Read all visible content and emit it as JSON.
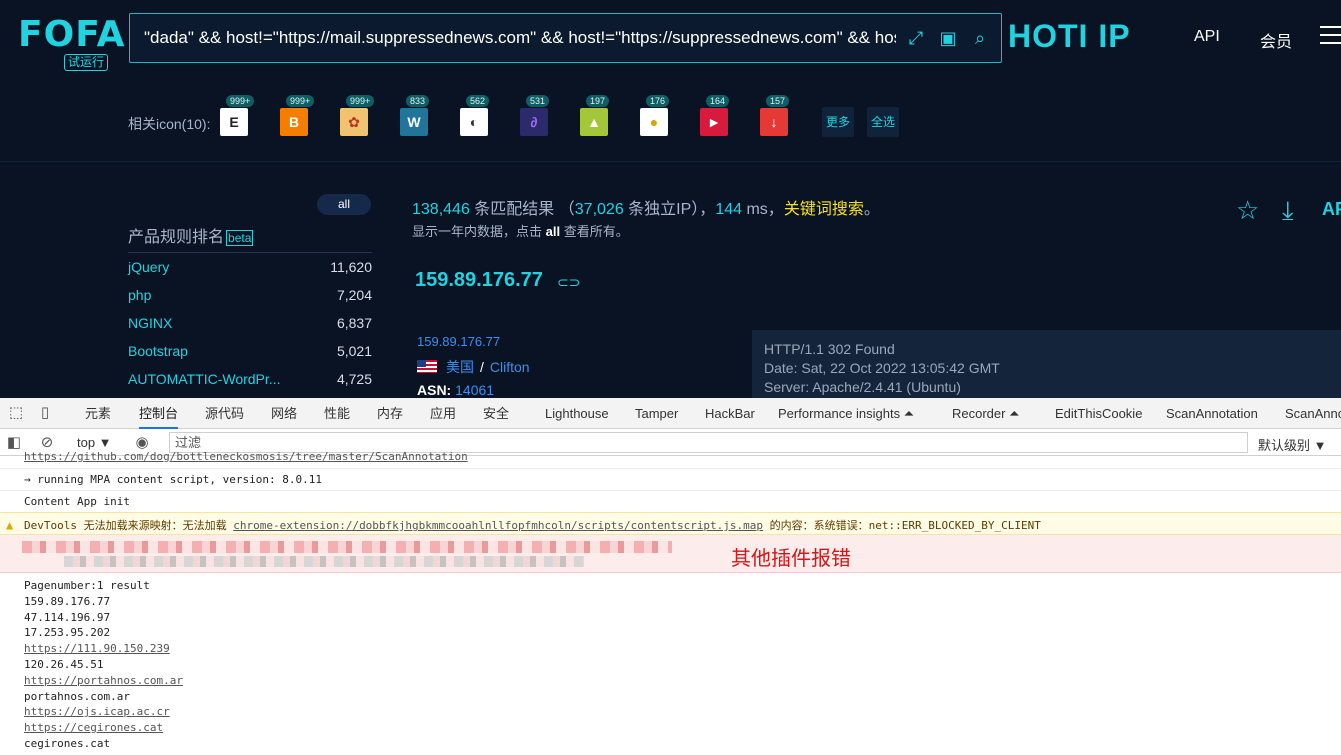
{
  "logo": {
    "text": "FOFA",
    "badge": "试运行"
  },
  "search": {
    "query": "\"dada\" && host!=\"https://mail.suppressednews.com\" && host!=\"https://suppressednews.com\" && host!=\"ti"
  },
  "header": {
    "hoti": "HOTI IP",
    "api": "API",
    "member": "会员"
  },
  "icons_row": {
    "label": "相关icon(10):",
    "items": [
      {
        "count": "999+",
        "glyph": "E",
        "bg": "#ffffff",
        "fg": "#222222"
      },
      {
        "count": "999+",
        "glyph": "B",
        "bg": "#f57d00",
        "fg": "#ffffff"
      },
      {
        "count": "999+",
        "glyph": "✿",
        "bg": "#f1c36e",
        "fg": "#b7352c"
      },
      {
        "count": "833",
        "glyph": "W",
        "bg": "#21759b",
        "fg": "#ffffff"
      },
      {
        "count": "562",
        "glyph": "◐",
        "bg": "#ffffff",
        "fg": "#333333"
      },
      {
        "count": "531",
        "glyph": "∂",
        "bg": "#2b2b6b",
        "fg": "#a26bff"
      },
      {
        "count": "197",
        "glyph": "▲",
        "bg": "#a4c639",
        "fg": "#ffffff"
      },
      {
        "count": "176",
        "glyph": "●",
        "bg": "#ffffff",
        "fg": "#d9a300"
      },
      {
        "count": "164",
        "glyph": "►",
        "bg": "#d81b3c",
        "fg": "#ffffff"
      },
      {
        "count": "157",
        "glyph": "↓",
        "bg": "#e53935",
        "fg": "#ffffff"
      }
    ],
    "more": "更多",
    "select_all": "全选"
  },
  "ranking": {
    "all_label": "all",
    "title": "产品规则排名",
    "beta": "beta",
    "rows": [
      {
        "name": "jQuery",
        "count": "11,620"
      },
      {
        "name": "php",
        "count": "7,204"
      },
      {
        "name": "NGINX",
        "count": "6,837"
      },
      {
        "name": "Bootstrap",
        "count": "5,021"
      },
      {
        "name": "AUTOMATTIC-WordPr...",
        "count": "4,725"
      }
    ]
  },
  "stats": {
    "matches": "138,446",
    "matches_label": "条匹配结果",
    "ip_open": "（",
    "unique_ip": "37,026",
    "unique_label": "条独立IP）",
    "comma1": "，",
    "ms": "144",
    "ms_label": "ms",
    "comma2": "，",
    "keyword": "关键词搜索",
    "period": "。",
    "sub_prefix": "显示一年内数据，点击",
    "sub_all": "all",
    "sub_suffix": "查看所有。"
  },
  "result": {
    "ip": "159.89.176.77",
    "ip_small": "159.89.176.77",
    "country": "美国",
    "separator": "/",
    "city": "Clifton",
    "asn_label": "ASN:",
    "asn": "14061",
    "http": [
      "HTTP/1.1 302 Found",
      "Date: Sat, 22 Oct 2022 13:05:42 GMT",
      "Server: Apache/2.4.41 (Ubuntu)"
    ]
  },
  "devtools": {
    "tabs": [
      "元素",
      "控制台",
      "源代码",
      "网络",
      "性能",
      "内存",
      "应用",
      "安全",
      "Lighthouse",
      "Tamper",
      "HackBar",
      "Performance insights ⏶",
      "Recorder ⏶",
      "EditThisCookie",
      "ScanAnnotation",
      "ScanAnnotation"
    ],
    "context": "top ▼",
    "filter_placeholder": "过滤",
    "level": "默认级别 ▼"
  },
  "console": {
    "top_link": "https://github.com/dog/bottleneckosmosis/tree/master/ScanAnnotation",
    "line1": "→ running MPA content script, version: 8.0.11",
    "line2": "Content App init",
    "warn_prefix": "DevTools 无法加载来源映射：无法加载",
    "warn_link": "chrome-extension://dobbfkjhgbkmmcooahlnllfopfmhcoln/scripts/contentscript.js.map",
    "warn_suffix": "的内容：系统错误：net::ERR_BLOCKED_BY_CLIENT",
    "error_annotation": "其他插件报错",
    "output": [
      {
        "text": "Pagenumber:1 result",
        "link": false
      },
      {
        "text": "159.89.176.77",
        "link": false
      },
      {
        "text": "47.114.196.97",
        "link": false
      },
      {
        "text": "17.253.95.202",
        "link": false
      },
      {
        "text": "https://111.90.150.239",
        "link": true
      },
      {
        "text": "120.26.45.51",
        "link": false
      },
      {
        "text": "https://portahnos.com.ar",
        "link": true
      },
      {
        "text": "portahnos.com.ar",
        "link": false
      },
      {
        "text": "https://ojs.icap.ac.cr",
        "link": true
      },
      {
        "text": "https://cegirones.cat",
        "link": true
      },
      {
        "text": "cegirones.cat",
        "link": false
      }
    ]
  }
}
